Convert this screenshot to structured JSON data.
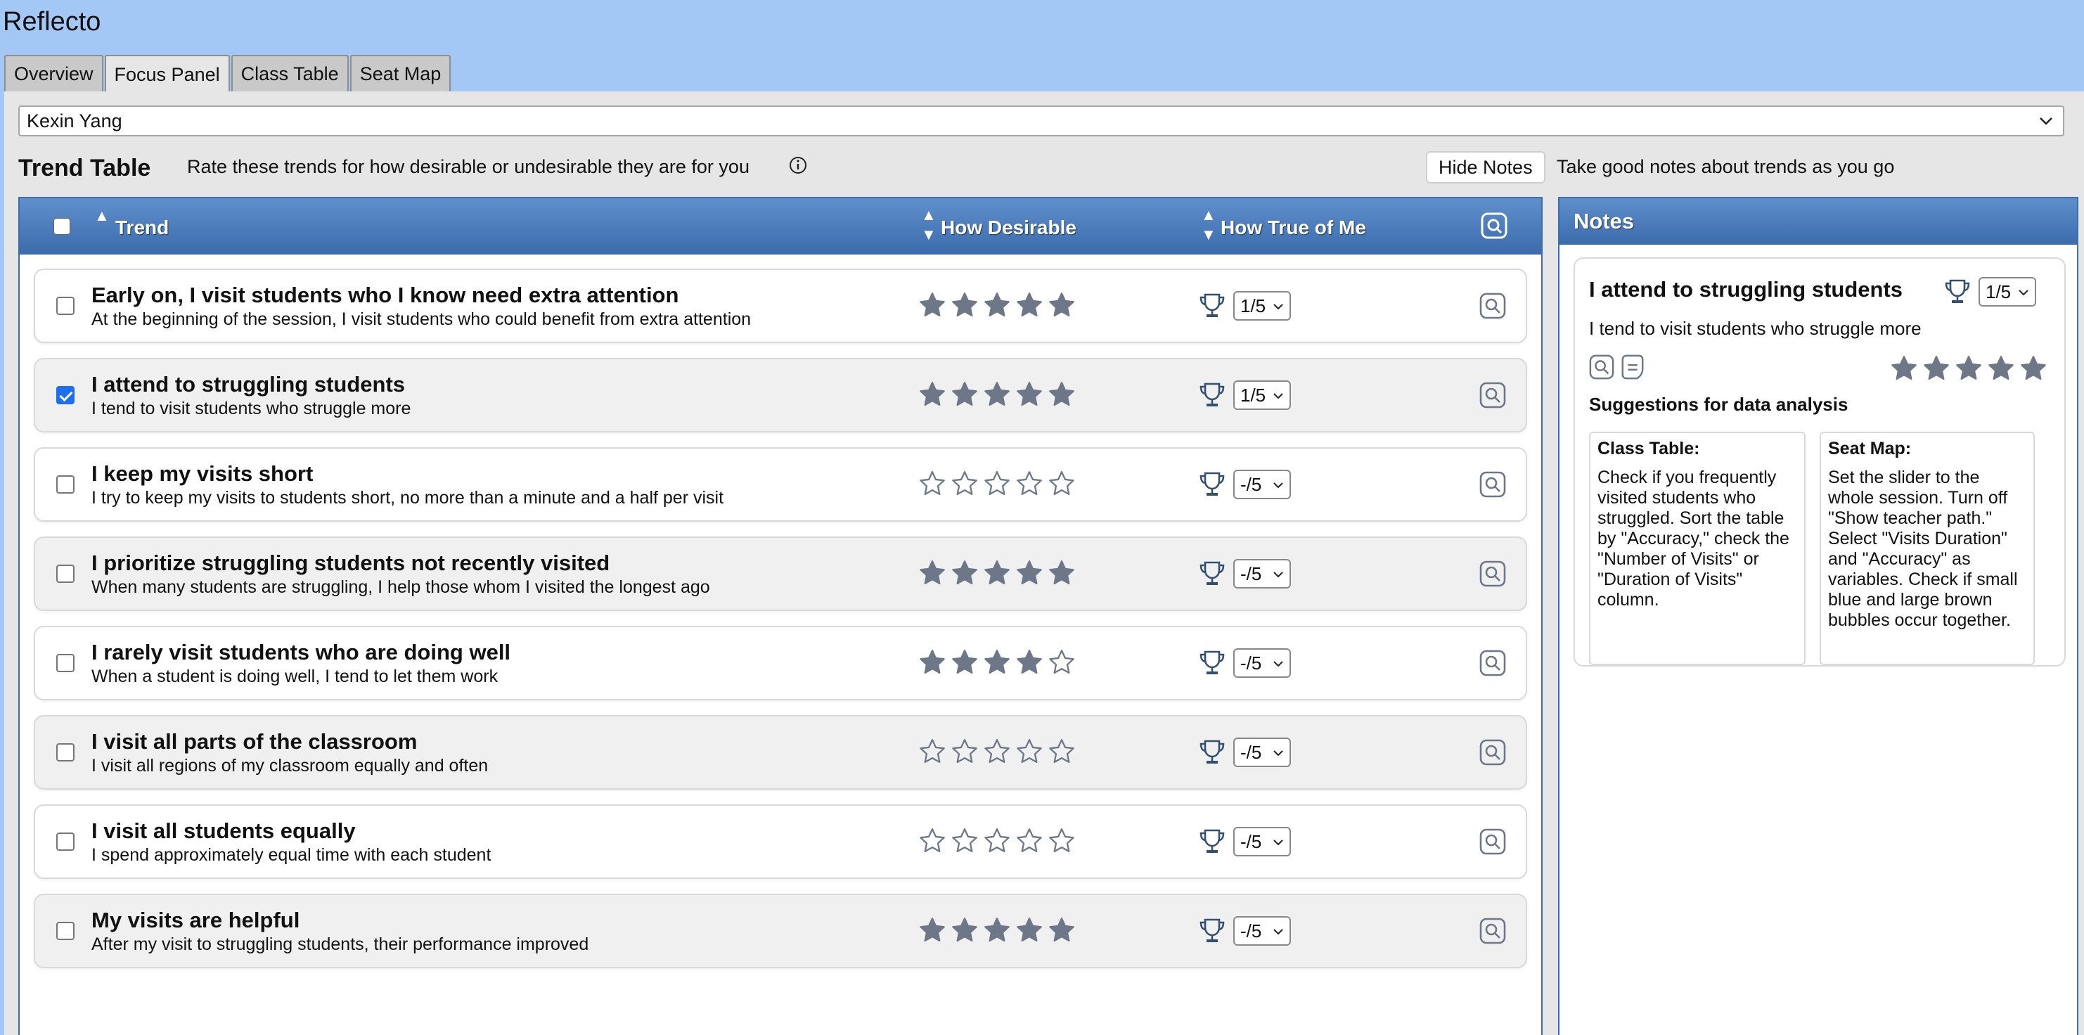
{
  "app": {
    "title": "Reflecto"
  },
  "tabs": [
    {
      "label": "Overview"
    },
    {
      "label": "Focus Panel"
    },
    {
      "label": "Class Table"
    },
    {
      "label": "Seat Map"
    }
  ],
  "student": {
    "selected": "Kexin Yang"
  },
  "trend_section": {
    "title": "Trend Table",
    "description": "Rate these trends for how desirable or undesirable they are for you",
    "hide_notes_label": "Hide Notes",
    "notes_description": "Take good notes about trends as you go"
  },
  "table": {
    "headers": {
      "trend": "Trend",
      "desirable": "How Desirable",
      "true_of_me": "How True of Me"
    },
    "rows": [
      {
        "title": "Early on, I visit students who I know need extra attention",
        "desc": "At the beginning of the session, I visit students who could benefit from extra attention",
        "checked": false,
        "stars": 5,
        "rating": "1/5"
      },
      {
        "title": "I attend to struggling students",
        "desc": "I tend to visit students who struggle more",
        "checked": true,
        "stars": 5,
        "rating": "1/5"
      },
      {
        "title": "I keep my visits short",
        "desc": "I try to keep my visits to students short, no more than a minute and a half per visit",
        "checked": false,
        "stars": 0,
        "rating": "-/5"
      },
      {
        "title": "I prioritize struggling students not recently visited",
        "desc": "When many students are struggling, I help those whom I visited the longest ago",
        "checked": false,
        "stars": 5,
        "rating": "-/5"
      },
      {
        "title": "I rarely visit students who are doing well",
        "desc": "When a student is doing well, I tend to let them work",
        "checked": false,
        "stars": 4,
        "rating": "-/5"
      },
      {
        "title": "I visit all parts of the classroom",
        "desc": "I visit all regions of my classroom equally and often",
        "checked": false,
        "stars": 0,
        "rating": "-/5"
      },
      {
        "title": "I visit all students equally",
        "desc": "I spend approximately equal time with each student",
        "checked": false,
        "stars": 0,
        "rating": "-/5"
      },
      {
        "title": "My visits are helpful",
        "desc": "After my visit to struggling students, their performance improved",
        "checked": false,
        "stars": 5,
        "rating": "-/5"
      }
    ]
  },
  "notes": {
    "header": "Notes",
    "card": {
      "title": "I attend to struggling students",
      "rating": "1/5",
      "desc": "I tend to visit students who struggle more",
      "stars": 5,
      "suggestions_title": "Suggestions for data analysis",
      "suggestions": [
        {
          "heading": "Class Table:",
          "text": "Check if you frequently visited students who struggled. Sort the table by \"Accuracy,\" check the \"Number of Visits\" or \"Duration of Visits\" column."
        },
        {
          "heading": "Seat Map:",
          "text": "Set the slider to the whole session. Turn off \"Show teacher path.\" Select \"Visits Duration\" and \"Accuracy\" as variables. Check if small blue and large brown bubbles occur together."
        }
      ]
    }
  },
  "colors": {
    "header_blue": "#3c6bac",
    "star": "#6e7787",
    "checkbox_checked": "#1e6ff0",
    "top_bar": "#a4c8f5"
  }
}
